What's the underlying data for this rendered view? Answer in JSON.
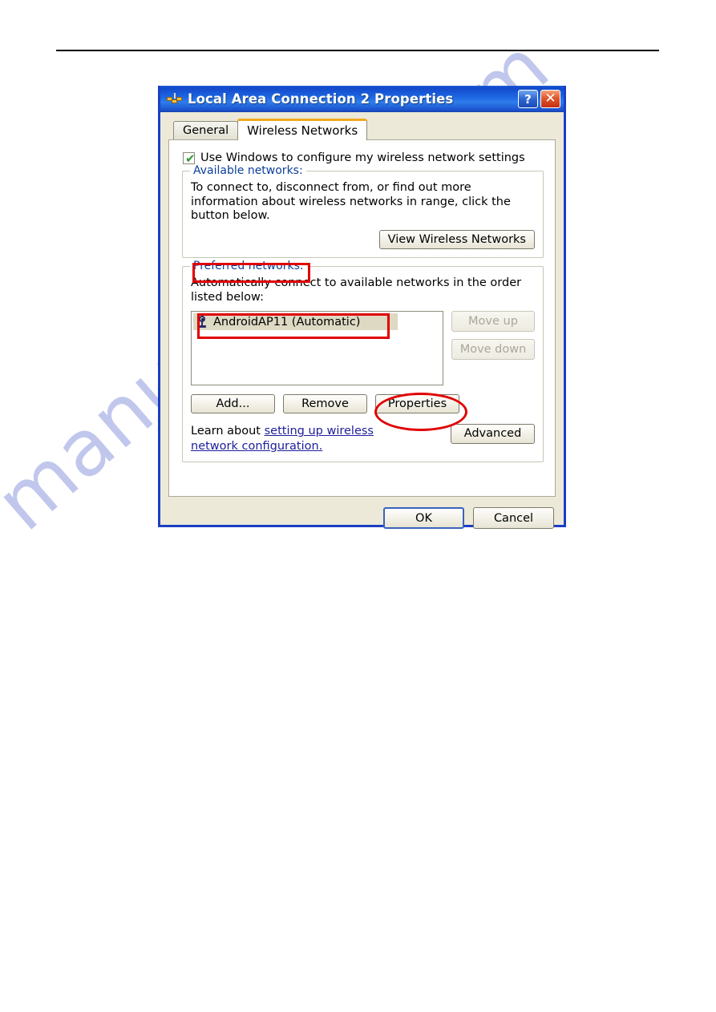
{
  "page": {
    "watermark": "manualshive.com"
  },
  "dialog": {
    "title": "Local Area Connection 2 Properties",
    "window_icon": "network-connection-icon",
    "help_button": "?",
    "close_button": "✕",
    "tabs": [
      {
        "label": "General",
        "active": false
      },
      {
        "label": "Wireless Networks",
        "active": true
      }
    ],
    "use_windows_checkbox": {
      "label": "Use Windows to configure my wireless network settings",
      "checked": true,
      "check_glyph": "✔"
    },
    "available_networks": {
      "legend": "Available networks:",
      "description": "To connect to, disconnect from, or find out more information about wireless networks in range, click the button below.",
      "view_button": "View Wireless Networks"
    },
    "preferred_networks": {
      "legend": "Preferred networks:",
      "description": "Automatically connect to available networks in the order listed below:",
      "items": [
        {
          "name": "AndroidAP11 (Automatic)",
          "icon": "wireless-access-point-icon",
          "selected": true
        }
      ],
      "move_up_button": "Move up",
      "move_down_button": "Move down",
      "add_button": "Add...",
      "remove_button": "Remove",
      "properties_button": "Properties",
      "learn_prefix": "Learn about ",
      "learn_link": "setting up wireless network configuration.",
      "advanced_button": "Advanced"
    },
    "footer": {
      "ok_button": "OK",
      "cancel_button": "Cancel"
    }
  },
  "annotations": {
    "preferred_networks_highlight": "red-rectangle",
    "preferred_list_item_highlight": "red-rectangle",
    "properties_button_highlight": "red-ellipse"
  },
  "colors": {
    "titlebar_blue": "#1d64e0",
    "dialog_face": "#ece9d8",
    "active_tab_accent": "#f0a81e",
    "group_legend_blue": "#0b3f9c",
    "link_blue": "#1d1d9c",
    "annotation_red": "#e00000",
    "checkbox_green": "#2f9c2f",
    "selection_beige": "#ded9c3",
    "watermark_blue": "#b9c0ea"
  }
}
